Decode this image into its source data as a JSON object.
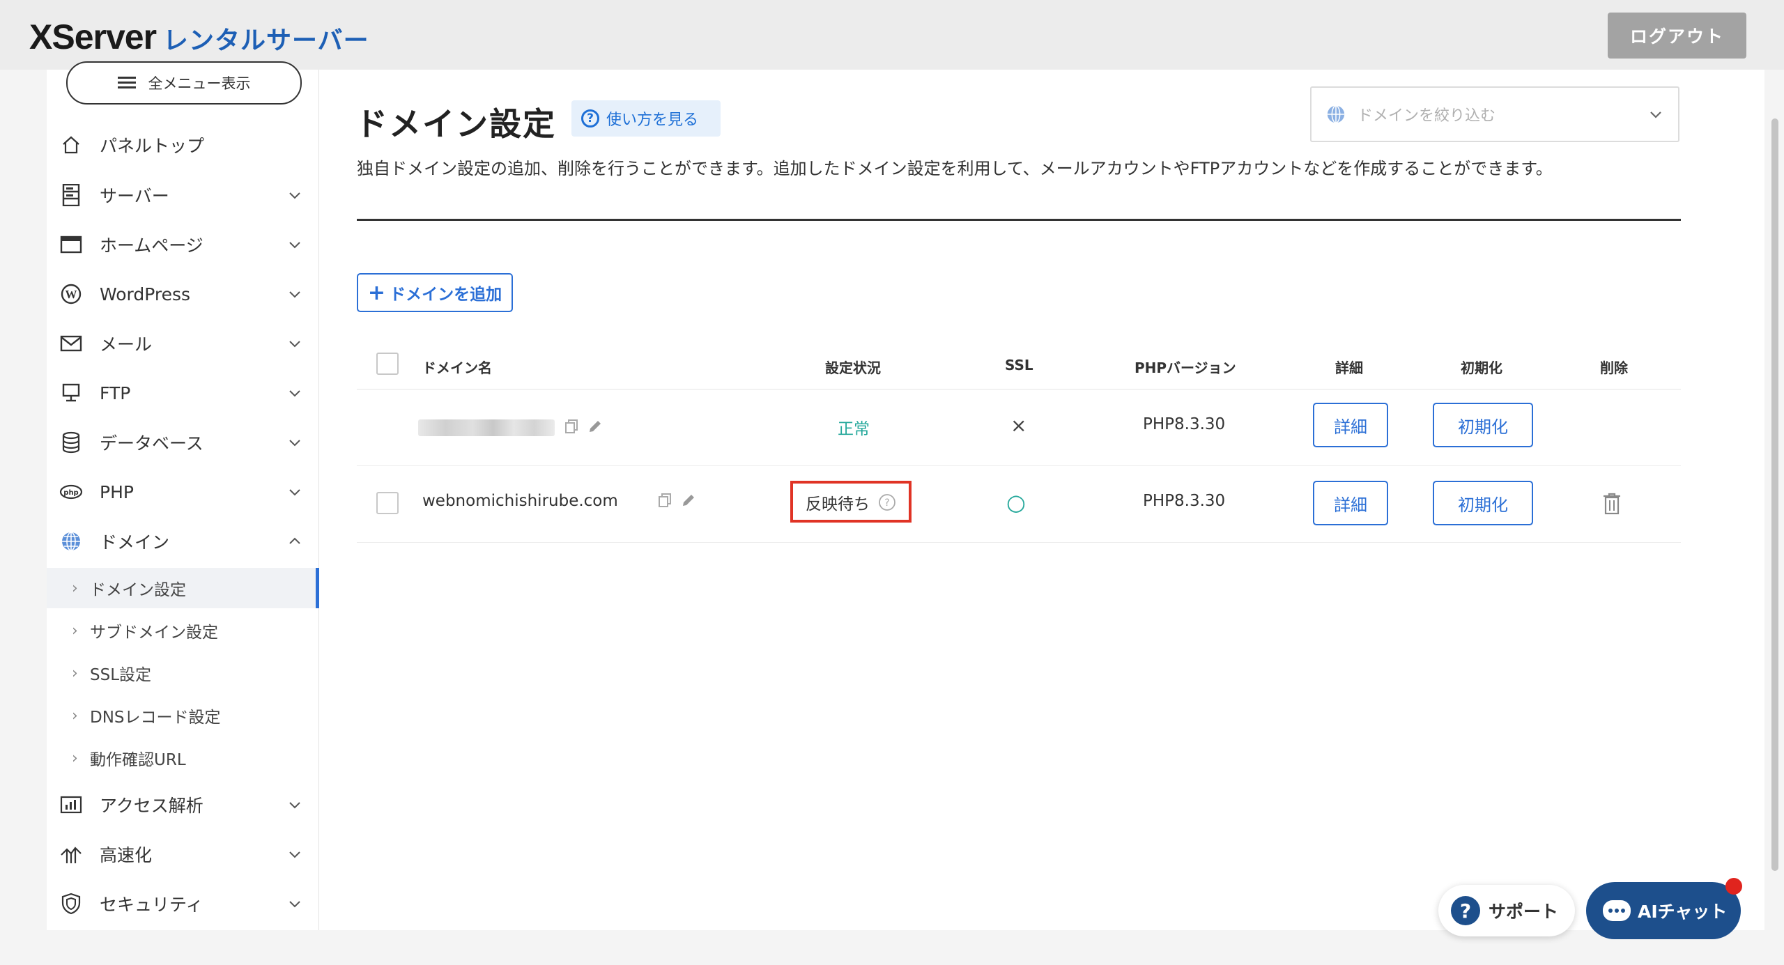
{
  "header": {
    "logo_main": "XServer",
    "logo_sub": "レンタルサーバー",
    "logout_label": "ログアウト"
  },
  "sidebar": {
    "all_menu_label": "全メニュー表示",
    "items": [
      {
        "label": "パネルトップ",
        "icon": "home-icon"
      },
      {
        "label": "サーバー",
        "icon": "server-icon"
      },
      {
        "label": "ホームページ",
        "icon": "browser-window-icon"
      },
      {
        "label": "WordPress",
        "icon": "wordpress-icon"
      },
      {
        "label": "メール",
        "icon": "mail-icon"
      },
      {
        "label": "FTP",
        "icon": "ftp-monitor-icon"
      },
      {
        "label": "データベース",
        "icon": "database-icon"
      },
      {
        "label": "PHP",
        "icon": "php-icon"
      },
      {
        "label": "ドメイン",
        "icon": "globe-icon"
      }
    ],
    "domain_subitems": [
      {
        "label": "ドメイン設定",
        "active": true
      },
      {
        "label": "サブドメイン設定"
      },
      {
        "label": "SSL設定"
      },
      {
        "label": "DNSレコード設定"
      },
      {
        "label": "動作確認URL"
      }
    ],
    "lower_items": [
      {
        "label": "アクセス解析",
        "icon": "bar-chart-icon"
      },
      {
        "label": "高速化",
        "icon": "speed-icon"
      },
      {
        "label": "セキュリティ",
        "icon": "shield-icon"
      }
    ]
  },
  "main": {
    "title": "ドメイン設定",
    "howto_label": "使い方を見る",
    "filter_placeholder": "ドメインを絞り込む",
    "description": "独自ドメイン設定の追加、削除を行うことができます。追加したドメイン設定を利用して、メールアカウントやFTPアカウントなどを作成することができます。",
    "add_button_label": "ドメインを追加"
  },
  "table": {
    "columns": [
      "ドメイン名",
      "設定状況",
      "SSL",
      "PHPバージョン",
      "詳細",
      "初期化",
      "削除"
    ],
    "rows": [
      {
        "domain": "",
        "status": "正常",
        "ssl": "×",
        "php": "PHP8.3.30",
        "detail_label": "詳細",
        "reset_label": "初期化"
      },
      {
        "domain": "webnomichishirube.com",
        "status": "反映待ち",
        "ssl": "○",
        "php": "PHP8.3.30",
        "detail_label": "詳細",
        "reset_label": "初期化"
      }
    ]
  },
  "floating": {
    "support_label": "サポート",
    "ai_chat_label": "AIチャット"
  },
  "colors": {
    "accent": "#2b6fd6",
    "brand_blue": "#1d5fb5",
    "status_ok": "#25a89b",
    "highlight_red": "#e03325",
    "chat_navy": "#1d4f8c"
  }
}
